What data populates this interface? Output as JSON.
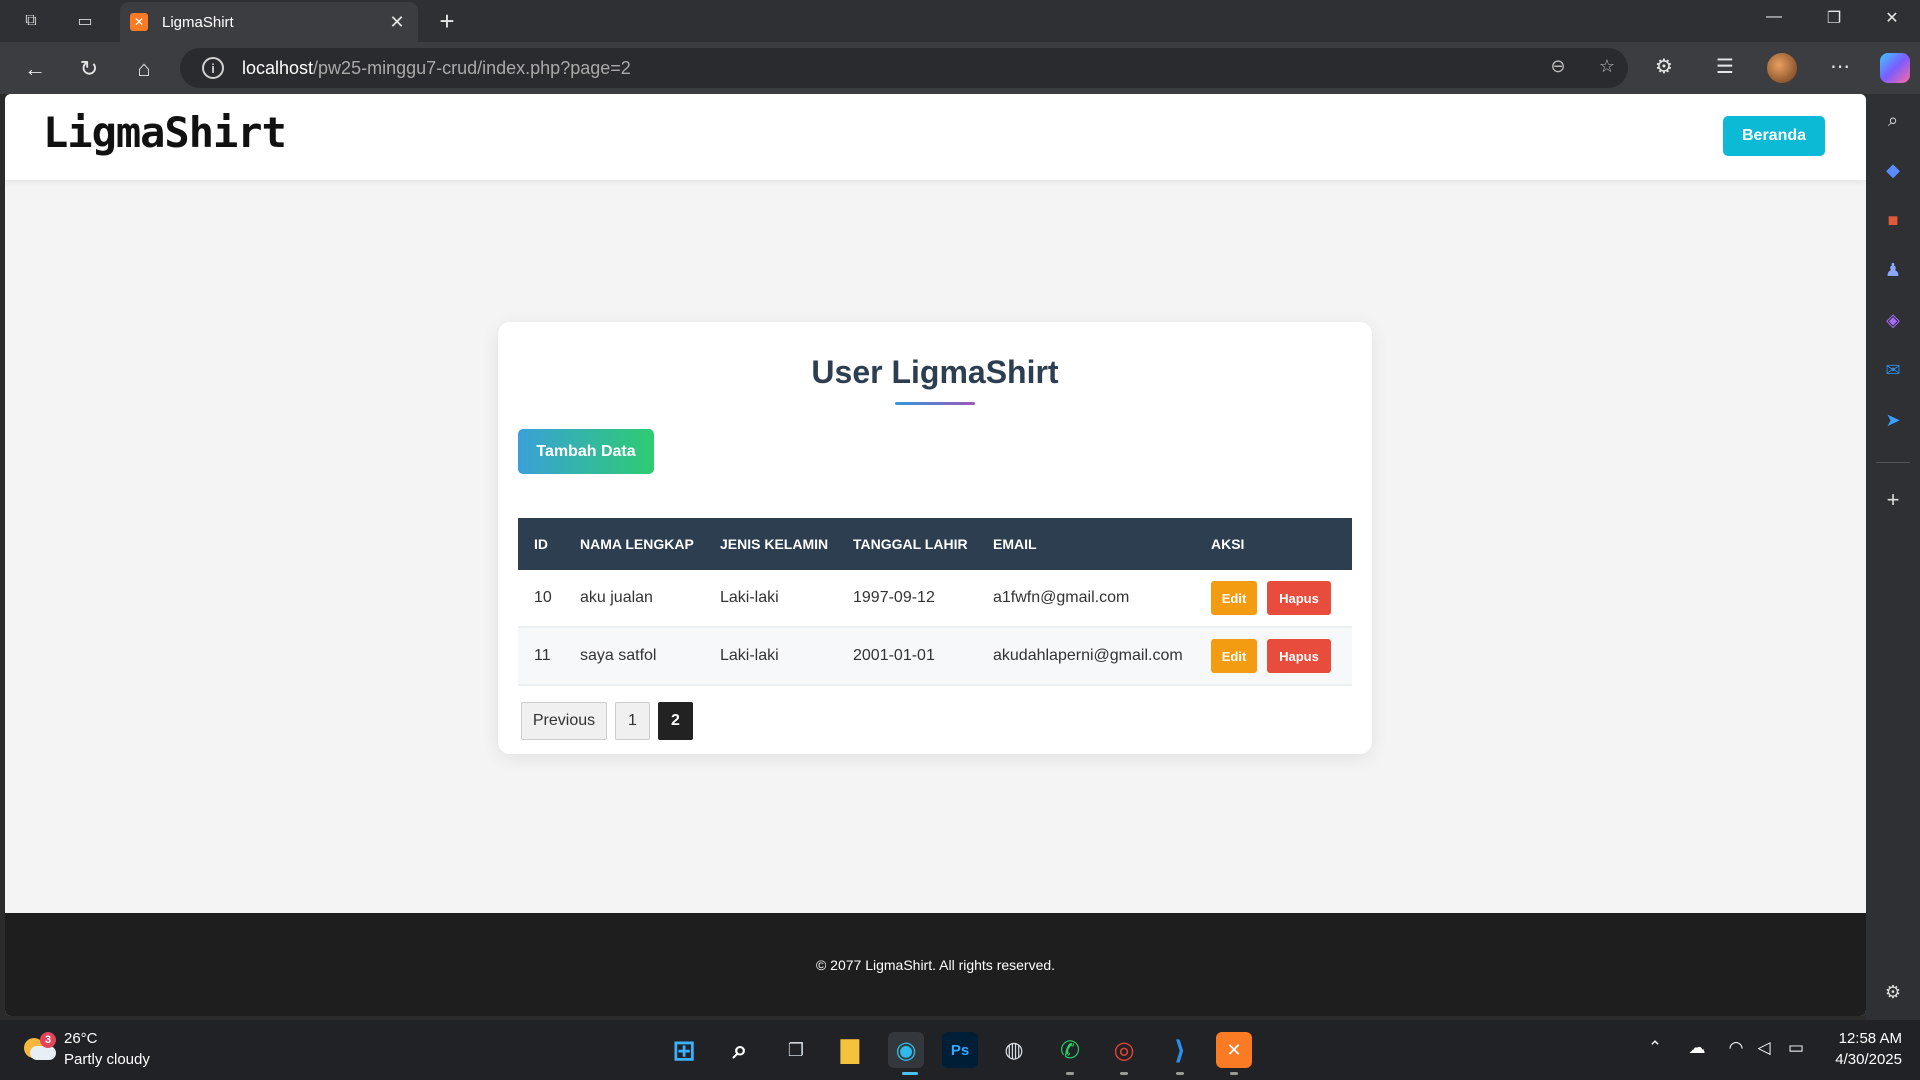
{
  "browser": {
    "tab_title": "LigmaShirt",
    "tab_favicon": "xampp-icon",
    "url_host": "localhost",
    "url_path": "/pw25-minggu7-crud/index.php?page=2"
  },
  "site": {
    "logo": "LigmaShirt",
    "nav_button": "Beranda"
  },
  "card": {
    "title": "User LigmaShirt",
    "add_button": "Tambah Data"
  },
  "table": {
    "headers": [
      "ID",
      "NAMA LENGKAP",
      "JENIS KELAMIN",
      "TANGGAL LAHIR",
      "EMAIL",
      "AKSI"
    ],
    "rows": [
      {
        "id": "10",
        "nama": "aku jualan",
        "jenis_kelamin": "Laki-laki",
        "tanggal_lahir": "1997-09-12",
        "email": "a1fwfn@gmail.com"
      },
      {
        "id": "11",
        "nama": "saya satfol",
        "jenis_kelamin": "Laki-laki",
        "tanggal_lahir": "2001-01-01",
        "email": "akudahlaperni@gmail.com"
      }
    ],
    "edit_label": "Edit",
    "delete_label": "Hapus"
  },
  "pagination": {
    "previous": "Previous",
    "pages": [
      "1",
      "2"
    ],
    "current_page": "2"
  },
  "footer": {
    "text": "© 2077 LigmaShirt. All rights reserved."
  },
  "taskbar": {
    "weather_temp": "26°C",
    "weather_desc": "Partly cloudy",
    "weather_badge": "3",
    "ps_label": "Ps",
    "time": "12:58 AM",
    "date": "4/30/2025"
  },
  "colors": {
    "header_dark": "#2c3e50",
    "beranda": "#0cbad6",
    "edit": "#f39c12",
    "hapus": "#e74c3c",
    "footer": "#1e1e1e"
  }
}
